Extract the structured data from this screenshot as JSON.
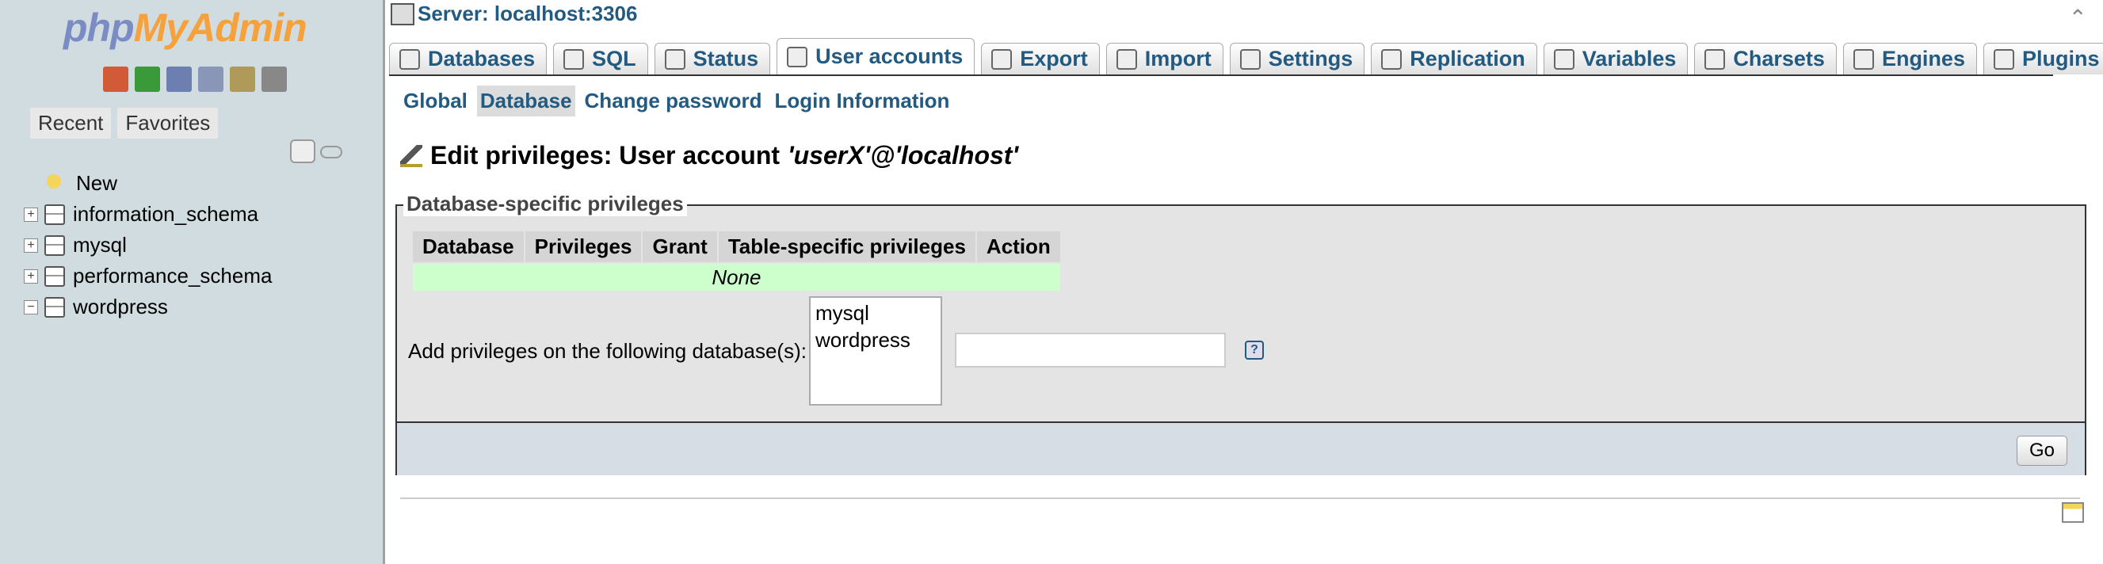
{
  "logo": {
    "part1": "php",
    "part2": "MyAdmin"
  },
  "nav": {
    "icons": [
      "home-icon",
      "logout-icon",
      "docs-icon",
      "sql-docs-icon",
      "settings-icon",
      "reload-icon"
    ],
    "tabs": {
      "recent": "Recent",
      "favorites": "Favorites"
    },
    "tree": [
      {
        "label": "New",
        "expander": ""
      },
      {
        "label": "information_schema",
        "expander": "+"
      },
      {
        "label": "mysql",
        "expander": "+"
      },
      {
        "label": "performance_schema",
        "expander": "+"
      },
      {
        "label": "wordpress",
        "expander": "−"
      }
    ]
  },
  "server": {
    "label": "Server: localhost:3306"
  },
  "tabs": [
    {
      "label": "Databases",
      "icon": "databases-icon"
    },
    {
      "label": "SQL",
      "icon": "sql-icon"
    },
    {
      "label": "Status",
      "icon": "status-icon"
    },
    {
      "label": "User accounts",
      "icon": "users-icon",
      "active": true
    },
    {
      "label": "Export",
      "icon": "export-icon"
    },
    {
      "label": "Import",
      "icon": "import-icon"
    },
    {
      "label": "Settings",
      "icon": "settings-icon"
    },
    {
      "label": "Replication",
      "icon": "replication-icon"
    },
    {
      "label": "Variables",
      "icon": "variables-icon"
    },
    {
      "label": "Charsets",
      "icon": "charsets-icon"
    },
    {
      "label": "Engines",
      "icon": "engines-icon"
    },
    {
      "label": "Plugins",
      "icon": "plugins-icon"
    }
  ],
  "subtabs": {
    "global": "Global",
    "database": "Database",
    "change_password": "Change password",
    "login_info": "Login Information"
  },
  "page": {
    "title_prefix": "Edit privileges: User account ",
    "title_account": "'userX'@'localhost'"
  },
  "privileges": {
    "legend": "Database-specific privileges",
    "headers": {
      "database": "Database",
      "privileges": "Privileges",
      "grant": "Grant",
      "table_specific": "Table-specific privileges",
      "action": "Action"
    },
    "empty": "None",
    "add_label": "Add privileges on the following database(s):",
    "db_options": [
      "mysql",
      "wordpress"
    ],
    "help": "?",
    "go": "Go"
  }
}
